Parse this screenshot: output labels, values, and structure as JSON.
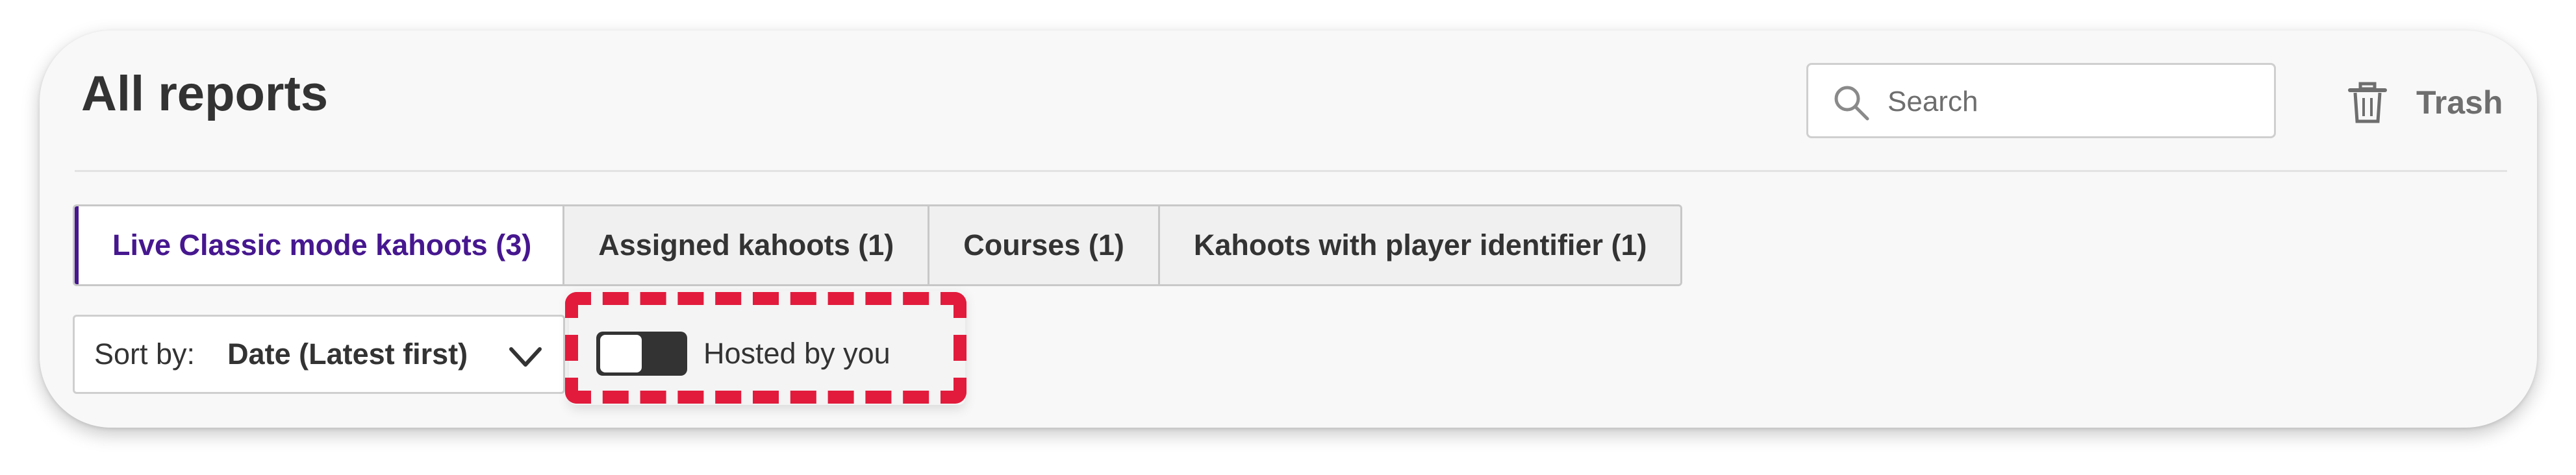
{
  "header": {
    "title": "All reports",
    "search": {
      "placeholder": "Search",
      "value": ""
    },
    "trash_label": "Trash"
  },
  "tabs": [
    {
      "label": "Live Classic mode kahoots (3)",
      "active": true
    },
    {
      "label": "Assigned kahoots (1)",
      "active": false
    },
    {
      "label": "Courses (1)",
      "active": false
    },
    {
      "label": "Kahoots with player identifier (1)",
      "active": false
    }
  ],
  "filters": {
    "sort_label": "Sort by:",
    "sort_value": "Date (Latest first)",
    "hosted_toggle": {
      "label": "Hosted by you",
      "on": false
    }
  },
  "icons": {
    "search": "search-icon",
    "trash": "trash-icon",
    "sort_chevron": "chevron-down-icon"
  },
  "colors": {
    "accent": "#46178f",
    "highlight": "#e21b3c",
    "text": "#333333",
    "muted": "#6e6e6e"
  }
}
